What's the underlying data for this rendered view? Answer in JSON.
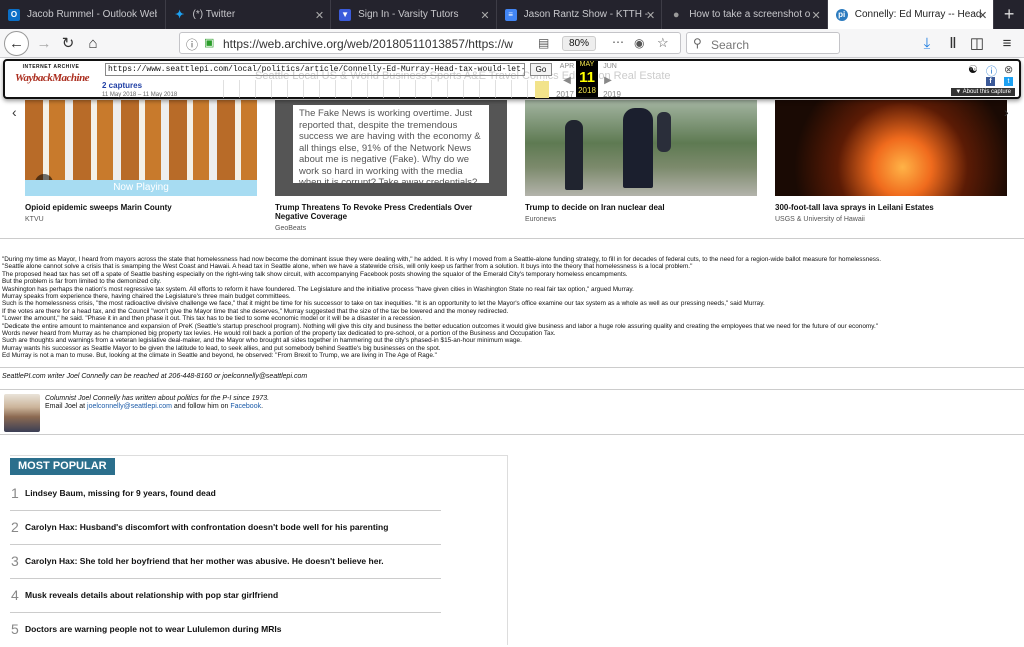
{
  "browser": {
    "tabs": [
      {
        "title": "Jacob Rummel - Outlook Web A",
        "icon": "outlook-icon",
        "color": "#0b6fc7"
      },
      {
        "title": "(*) Twitter",
        "icon": "twitter-icon",
        "color": "#1da1f2"
      },
      {
        "title": "Sign In - Varsity Tutors",
        "icon": "shield-icon",
        "color": "#3b5bdb"
      },
      {
        "title": "Jason Rantz Show - KTTH -",
        "icon": "docs-icon",
        "color": "#4285f4"
      },
      {
        "title": "How to take a screenshot o",
        "icon": "apple-icon",
        "color": "#888888"
      },
      {
        "title": "Connelly: Ed Murray -- Head",
        "icon": "pi-icon",
        "color": "#2c7bbf",
        "active": true
      }
    ],
    "url": "https://web.archive.org/web/20180511013857/https://w",
    "url_host": "web.archive.org",
    "zoom": "80%",
    "search_placeholder": "Search"
  },
  "wayback": {
    "logo_top": "INTERNET ARCHIVE",
    "logo_main": "WaybackMachine",
    "input_url": "https://www.seattlepi.com/local/politics/article/Connelly-Ed-Murray-Head-tax-would-let-feds-12905388.php",
    "go": "Go",
    "captures": "2 captures",
    "captures_range": "11 May 2018 – 11 May 2018",
    "prev_month": "APR",
    "cur_month": "MAY",
    "next_month": "JUN",
    "day": "11",
    "prev_year": "2017",
    "cur_year": "2018",
    "next_year": "2019",
    "about": "▼ About this capture",
    "ghost_nav": "Seattle    Local    US & World    Business    Sports    A&E         Travel    Comics    Education    Real Estate"
  },
  "carousel": [
    {
      "title": "Opioid epidemic sweeps Marin County",
      "source": "KTVU",
      "overlay": "Now Playing"
    },
    {
      "title": "Trump Threatens To Revoke Press Credentials Over Negative Coverage",
      "source": "GeoBeats",
      "tweet": "The Fake News is working overtime. Just reported that, despite the tremendous success we are having with the economy & all things else, 91% of the Network News about me is negative (Fake). Why do we work so hard in working with the media when it is corrupt? Take away credentials?"
    },
    {
      "title": "Trump to decide on Iran nuclear deal",
      "source": "Euronews"
    },
    {
      "title": "300-foot-tall lava sprays in Leilani Estates",
      "source": "USGS & University of Hawaii"
    }
  ],
  "article": [
    "\"During my time as Mayor, I heard from mayors across the state that homelessness had now become the dominant issue they were dealing with,\" he added. It is why I moved from a Seattle-alone funding strategy, to fill in for decades of federal cuts, to the need for a region-wide ballot measure for homelessness.",
    "\"Seattle alone cannot solve a crisis that is swamping the West Coast and Hawaii. A head tax in Seattle alone, when we have a statewide crisis, will only keep us farther from a solution. It buys into the theory that homelessness is a local problem.\"",
    "The proposed head tax has set off a spate of Seattle bashing especially on the right-wing talk show circuit, with accompanying Facebook posts showing the squalor of the Emerald City's temporary homeless encampments.",
    "But the problem is far from limited to the demonized city.",
    "Washington has perhaps the nation's most regressive tax system. All efforts to reform it have foundered. The Legislature and the initiative process \"have given cities in Washington State no real fair tax option,\" argued Murray.",
    "Murray speaks from experience there, having chaired the Legislature's three main budget committees.",
    "Such is the homelessness crisis, \"the most radioactive divisive challenge we face,\" that it might be time for his successor to take on tax inequities. \"It is an opportunity to let the Mayor's office examine our tax system as a whole as well as our pressing needs,\" said Murray.",
    "If the votes are there for a head tax, and the Council \"won't give the Mayor time that she deserves,\" Murray suggested that the size of the tax be lowered and the money redirected.",
    "\"Lower the amount,\" he said. \"Phase it in and then phase it out. This tax has to be tied to some economic model or it will be a disaster in a recession.",
    "\"Dedicate the entire amount to maintenance and expansion of PreK (Seattle's startup preschool program). Nothing will give this city and business the better education outcomes it would give business and labor a huge role assuring quality and creating the employees that we need for the future of our economy.\"",
    "Words never heard from Murray as he championed big property tax levies. He would roll back a portion of the property tax dedicated to pre-school, or a portion of the Business and Occupation Tax.",
    "Such are thoughts and warnings from a veteran legislative deal-maker, and the Mayor who brought all sides together in hammering out the city's phased-in $15-an-hour minimum wage.",
    "Murray wants his successor as Seattle Mayor to be given the latitude to lead, to seek allies, and put somebody behind Seattle's big businesses on the spot.",
    "Ed Murray is not a man to muse. But, looking at the climate in Seattle and beyond, he observed: \"From Brexit to Trump, we are living in The Age of Rage.\""
  ],
  "byline": "SeattlePI.com writer Joel Connelly can be reached at 206-448-8160 or joelconnelly@seattlepi.com",
  "author": {
    "bio": "Columnist Joel Connelly has written about politics for the P-I since 1973.",
    "email_prefix": "Email Joel at ",
    "email": "joelconnelly@seattlepi.com",
    "follow": " and follow him on ",
    "facebook": "Facebook",
    "period": "."
  },
  "most_popular": {
    "heading": "MOST POPULAR",
    "items": [
      {
        "num": "1",
        "title": "Lindsey Baum, missing for 9 years, found dead"
      },
      {
        "num": "2",
        "title": "Carolyn Hax: Husband's discomfort with confrontation doesn't bode well for his parenting"
      },
      {
        "num": "3",
        "title": "Carolyn Hax: She told her boyfriend that her mother was abusive. He doesn't believe her."
      },
      {
        "num": "4",
        "title": "Musk reveals details about relationship with pop star girlfriend"
      },
      {
        "num": "5",
        "title": "Doctors are warning people not to wear Lululemon during MRIs"
      }
    ]
  }
}
